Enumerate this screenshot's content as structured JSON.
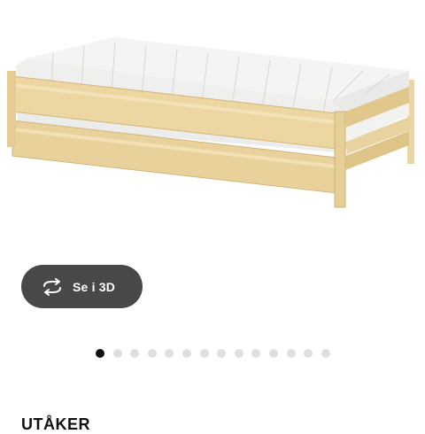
{
  "view_3d": {
    "label": "Se i 3D",
    "icon": "rotate-3d-icon"
  },
  "carousel": {
    "total": 14,
    "active_index": 0
  },
  "product": {
    "name": "UTÅKER"
  },
  "colors": {
    "button_bg": "#484848",
    "dot_active": "#111111",
    "dot_inactive": "#dfdfdf"
  }
}
